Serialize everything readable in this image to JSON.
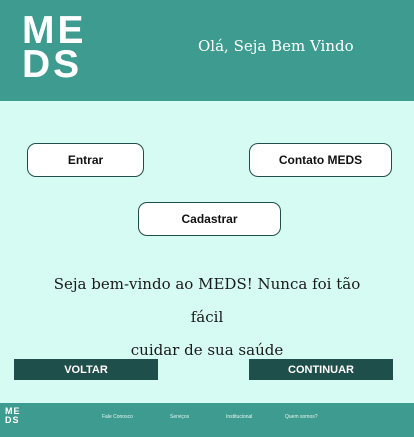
{
  "header": {
    "logo_line1": "ME",
    "logo_line2": "DS",
    "greeting": "Olá, Seja Bem Vindo"
  },
  "buttons": {
    "entrar": "Entrar",
    "contato": "Contato MEDS",
    "cadastrar": "Cadastrar"
  },
  "welcome": {
    "line1": "Seja bem-vindo ao MEDS! Nunca foi tão fácil",
    "line2": "cuidar de sua saúde"
  },
  "actions": {
    "voltar": "VOLTAR",
    "continuar": "CONTINUAR"
  },
  "footer": {
    "logo_line1": "ME",
    "logo_line2": "DS",
    "links": [
      "Fale Conosco",
      "Serviços",
      "Institucional",
      "Quem somos?"
    ]
  },
  "colors": {
    "header_bg": "#3e9b8f",
    "page_bg": "#d6fbf3",
    "dark_button": "#1f4f4a"
  }
}
